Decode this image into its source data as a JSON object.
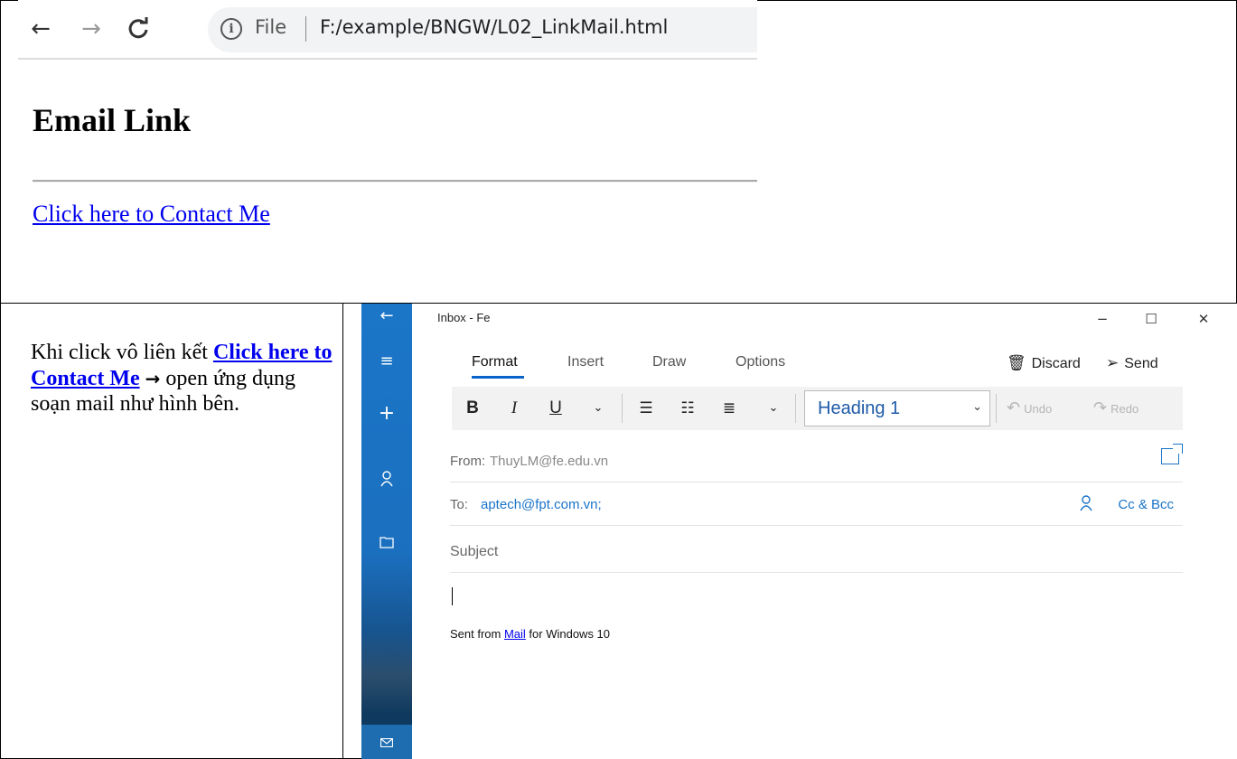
{
  "browser": {
    "nav": {
      "back": "←",
      "forward": "→",
      "reload": "C"
    },
    "address": {
      "scheme_label": "File",
      "url": "F:/example/BNGW/L02_LinkMail.html"
    },
    "page": {
      "heading": "Email Link",
      "link_text": "Click here to Contact Me"
    }
  },
  "explanation": {
    "prefix": "Khi click vô liên kết ",
    "link_text": "Click here to Contact Me",
    "arrow": "→",
    "suffix": " open ứng dụng soạn mail như hình bên."
  },
  "mail_app": {
    "window_title": "Inbox - Fe",
    "window_controls": {
      "minimize": "−",
      "maximize": "☐",
      "close": "✕"
    },
    "rail_icons": [
      "back-arrow",
      "hamburger-menu",
      "new-mail-plus",
      "person",
      "folder",
      "mail"
    ],
    "tabs": [
      {
        "label": "Format",
        "active": true
      },
      {
        "label": "Insert",
        "active": false
      },
      {
        "label": "Draw",
        "active": false
      },
      {
        "label": "Options",
        "active": false
      }
    ],
    "actions": {
      "discard": "Discard",
      "send": "Send"
    },
    "toolbar": {
      "bold": "B",
      "italic": "I",
      "underline": "U",
      "style_value": "Heading 1",
      "undo": "Undo",
      "redo": "Redo"
    },
    "fields": {
      "from_label": "From:",
      "from_value": "ThuyLM@fe.edu.vn",
      "to_label": "To:",
      "to_value": "aptech@fpt.com.vn;",
      "cc_bcc": "Cc & Bcc",
      "subject_placeholder": "Subject"
    },
    "signature": {
      "prefix": "Sent from ",
      "link": "Mail",
      "suffix": " for Windows 10"
    },
    "colors": {
      "accent": "#0a63c9",
      "rail": "#1b76c8",
      "link": "#1a73c8"
    }
  }
}
